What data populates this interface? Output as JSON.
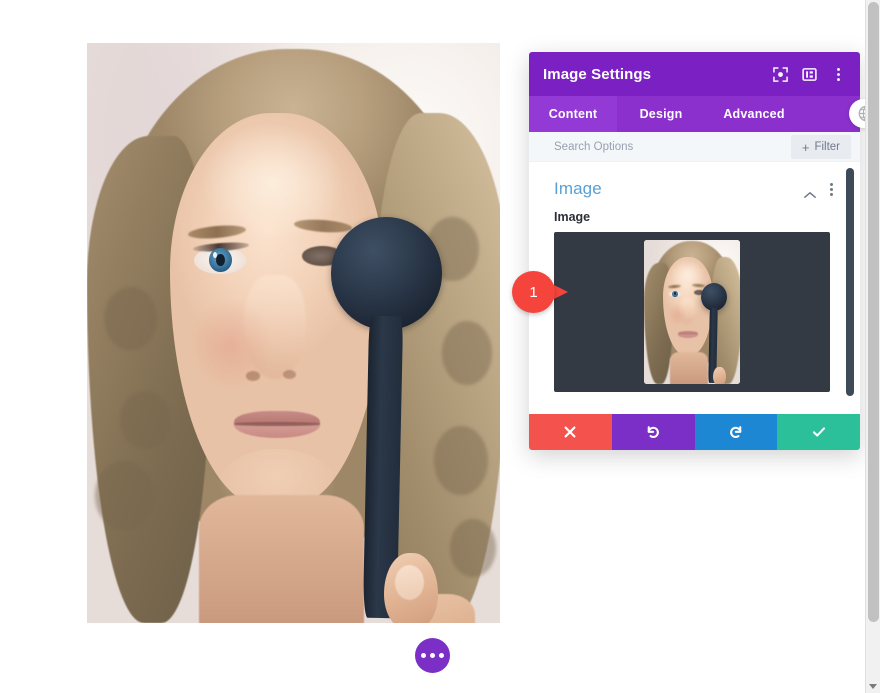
{
  "modal": {
    "title": "Image Settings",
    "header_icons": [
      {
        "name": "focus-target-icon"
      },
      {
        "name": "layout-panel-icon"
      },
      {
        "name": "kebab-menu-icon"
      }
    ],
    "tabs": [
      {
        "label": "Content",
        "active": true
      },
      {
        "label": "Design",
        "active": false
      },
      {
        "label": "Advanced",
        "active": false
      }
    ],
    "search": {
      "placeholder": "Search Options",
      "value": ""
    },
    "filter_button": {
      "label": "Filter",
      "plus": "+"
    },
    "section": {
      "title": "Image",
      "collapse_icon": "chevron-up-icon",
      "menu_icon": "kebab-menu-icon"
    },
    "field": {
      "label": "Image",
      "upload_area_name": "image-upload-preview"
    },
    "footer_buttons": [
      {
        "name": "cancel-button",
        "glyph": "✕",
        "color": "#f4524d"
      },
      {
        "name": "undo-button",
        "glyph": "↺",
        "color": "#7b2fc7"
      },
      {
        "name": "redo-button",
        "glyph": "↻",
        "color": "#1e87d4"
      },
      {
        "name": "save-button",
        "glyph": "✓",
        "color": "#2bbf9a"
      }
    ]
  },
  "marker": {
    "number": "1",
    "color": "#f4443c"
  },
  "canvas": {
    "image_alt": "Portrait of a blonde woman holding a dark occluder paddle over one eye",
    "fab_name": "module-actions-button"
  },
  "colors": {
    "header_purple": "#7b21c4",
    "tab_bar_purple": "#8b30cc",
    "tab_active_purple": "#9339d6",
    "section_title_blue": "#5a9fd4",
    "upload_bg": "#333a43",
    "scrollbar_dark": "#3d4a58"
  }
}
